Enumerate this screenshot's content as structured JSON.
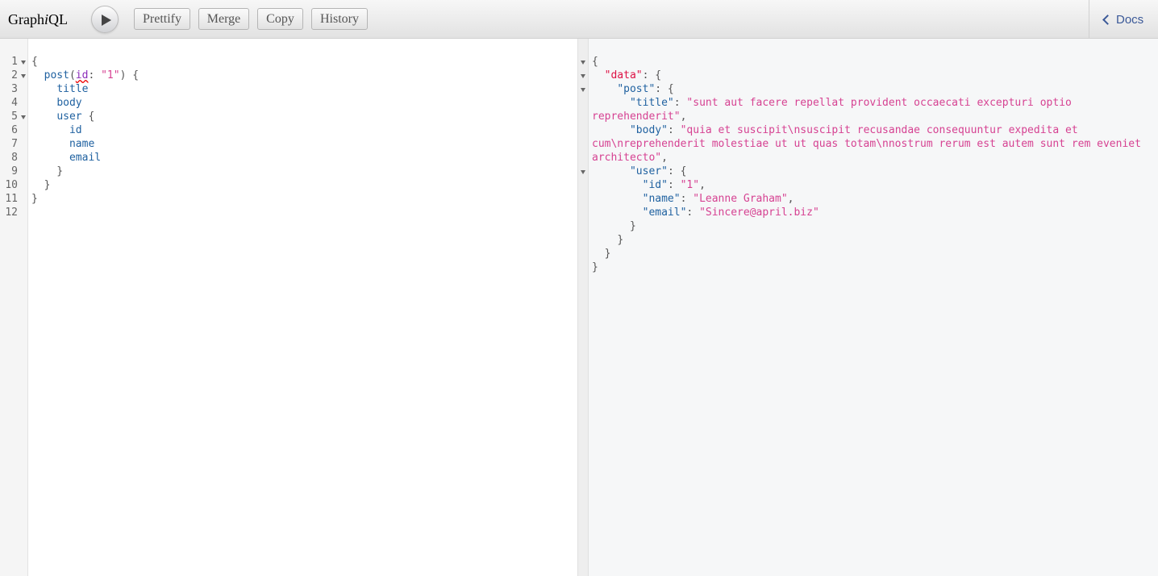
{
  "app": {
    "title_prefix": "Graph",
    "title_italic": "i",
    "title_suffix": "QL"
  },
  "toolbar": {
    "run_label": "",
    "buttons": [
      "Prettify",
      "Merge",
      "Copy",
      "History"
    ]
  },
  "docs": {
    "label": "Docs"
  },
  "editor": {
    "line_numbers": [
      "1",
      "2",
      "3",
      "4",
      "5",
      "6",
      "7",
      "8",
      "9",
      "10",
      "11",
      "12"
    ],
    "lines": [
      [
        "{"
      ],
      [
        "  ",
        "post",
        "(",
        "id",
        ": ",
        "\"1\"",
        ") {"
      ],
      [
        "    ",
        "title"
      ],
      [
        "    ",
        "body"
      ],
      [
        "    ",
        "user",
        " {"
      ],
      [
        "      ",
        "id"
      ],
      [
        "      ",
        "name"
      ],
      [
        "      ",
        "email"
      ],
      [
        "    }"
      ],
      [
        "  }"
      ],
      [
        "}"
      ],
      [
        ""
      ]
    ]
  },
  "result": {
    "data_key": "\"data\"",
    "post_key": "\"post\"",
    "title_key": "\"title\"",
    "title_value": "\"sunt aut facere repellat provident occaecati excepturi optio reprehenderit\"",
    "body_key": "\"body\"",
    "body_value": "\"quia et suscipit\\nsuscipit recusandae consequuntur expedita et cum\\nreprehenderit molestiae ut ut quas totam\\nnostrum rerum est autem sunt rem eveniet architecto\"",
    "user_key": "\"user\"",
    "id_key": "\"id\"",
    "id_value": "\"1\"",
    "name_key": "\"name\"",
    "name_value": "\"Leanne Graham\"",
    "email_key": "\"email\"",
    "email_value": "\"Sincere@april.biz\""
  }
}
